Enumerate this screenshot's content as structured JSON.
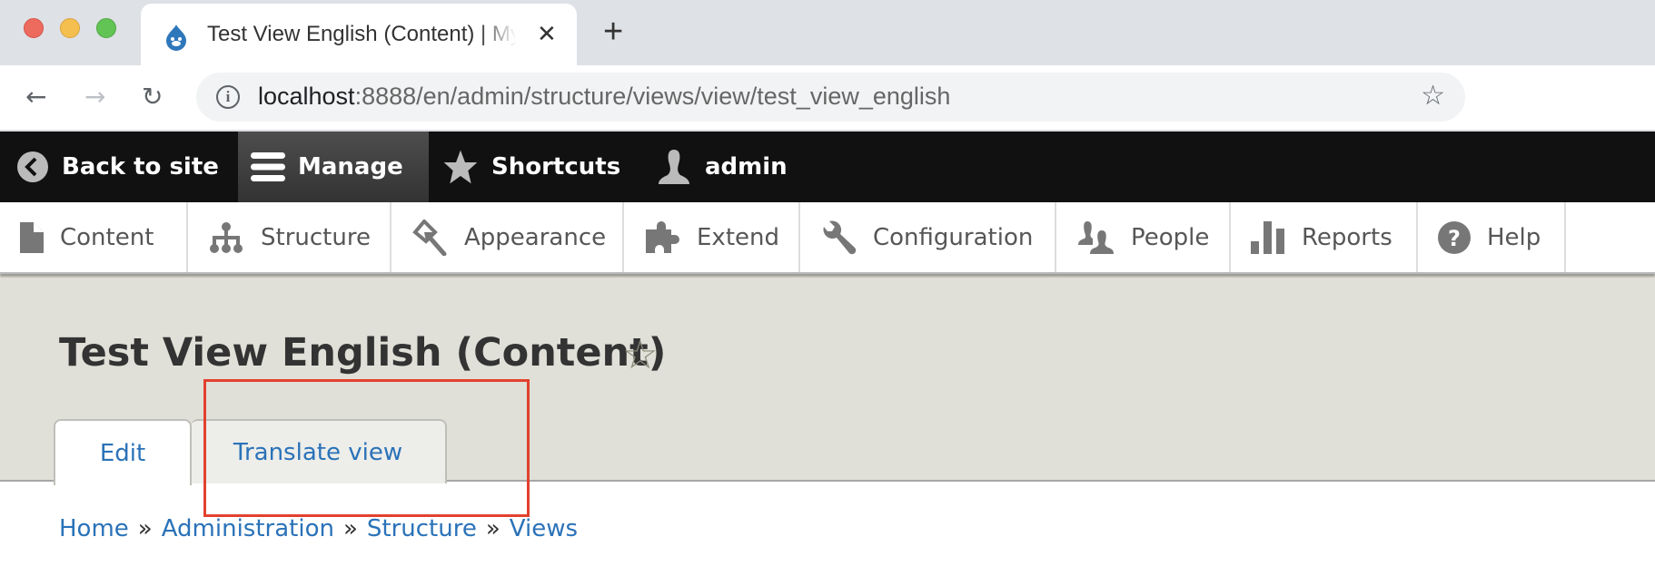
{
  "browser": {
    "tab_title": "Test View English (Content) | My",
    "tab_close": "✕",
    "new_tab": "+",
    "nav": {
      "back": "←",
      "forward": "→",
      "reload": "↻"
    },
    "url_host": "localhost",
    "url_rest": ":8888/en/admin/structure/views/view/test_view_english",
    "info_icon": "i",
    "bookmark_icon": "☆"
  },
  "toolbar": {
    "items": [
      {
        "label": "Back to site",
        "icon": "chevron-left-circle-icon"
      },
      {
        "label": "Manage",
        "icon": "hamburger-icon",
        "active": true
      },
      {
        "label": "Shortcuts",
        "icon": "star-icon"
      },
      {
        "label": "admin",
        "icon": "user-icon"
      }
    ]
  },
  "tray": {
    "items": [
      {
        "label": "Content",
        "icon": "file-icon"
      },
      {
        "label": "Structure",
        "icon": "hierarchy-icon"
      },
      {
        "label": "Appearance",
        "icon": "paint-icon"
      },
      {
        "label": "Extend",
        "icon": "puzzle-icon"
      },
      {
        "label": "Configuration",
        "icon": "wrench-icon"
      },
      {
        "label": "People",
        "icon": "people-icon"
      },
      {
        "label": "Reports",
        "icon": "bar-chart-icon"
      },
      {
        "label": "Help",
        "icon": "help-icon"
      }
    ]
  },
  "page": {
    "title": "Test View English (Content)",
    "title_star": "☆",
    "tabs": [
      {
        "label": "Edit",
        "active": true
      },
      {
        "label": "Translate view",
        "active": false
      }
    ],
    "breadcrumb": [
      "Home",
      "Administration",
      "Structure",
      "Views"
    ],
    "breadcrumb_sep": "»"
  },
  "colors": {
    "link": "#2a72b8",
    "toolbar_bg": "#111111",
    "header_bg": "#e0e0d8",
    "highlight": "#e2412f"
  }
}
